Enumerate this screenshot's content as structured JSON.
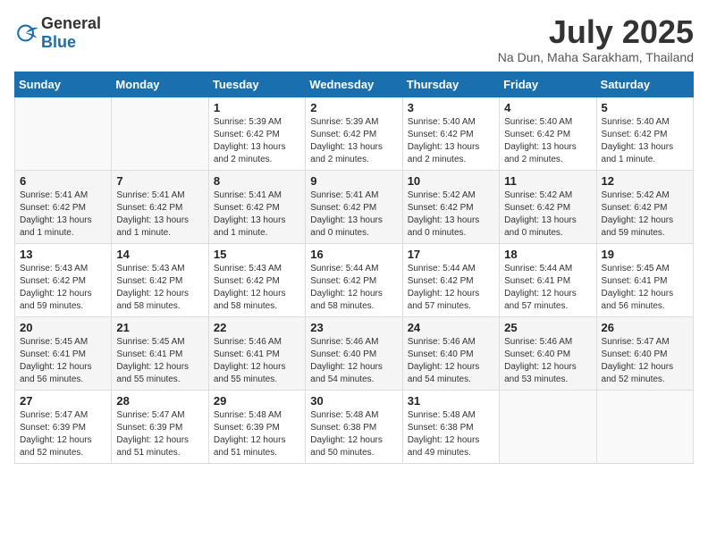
{
  "header": {
    "logo_general": "General",
    "logo_blue": "Blue",
    "month": "July 2025",
    "location": "Na Dun, Maha Sarakham, Thailand"
  },
  "weekdays": [
    "Sunday",
    "Monday",
    "Tuesday",
    "Wednesday",
    "Thursday",
    "Friday",
    "Saturday"
  ],
  "weeks": [
    [
      {
        "day": "",
        "info": ""
      },
      {
        "day": "",
        "info": ""
      },
      {
        "day": "1",
        "info": "Sunrise: 5:39 AM\nSunset: 6:42 PM\nDaylight: 13 hours and 2 minutes."
      },
      {
        "day": "2",
        "info": "Sunrise: 5:39 AM\nSunset: 6:42 PM\nDaylight: 13 hours and 2 minutes."
      },
      {
        "day": "3",
        "info": "Sunrise: 5:40 AM\nSunset: 6:42 PM\nDaylight: 13 hours and 2 minutes."
      },
      {
        "day": "4",
        "info": "Sunrise: 5:40 AM\nSunset: 6:42 PM\nDaylight: 13 hours and 2 minutes."
      },
      {
        "day": "5",
        "info": "Sunrise: 5:40 AM\nSunset: 6:42 PM\nDaylight: 13 hours and 1 minute."
      }
    ],
    [
      {
        "day": "6",
        "info": "Sunrise: 5:41 AM\nSunset: 6:42 PM\nDaylight: 13 hours and 1 minute."
      },
      {
        "day": "7",
        "info": "Sunrise: 5:41 AM\nSunset: 6:42 PM\nDaylight: 13 hours and 1 minute."
      },
      {
        "day": "8",
        "info": "Sunrise: 5:41 AM\nSunset: 6:42 PM\nDaylight: 13 hours and 1 minute."
      },
      {
        "day": "9",
        "info": "Sunrise: 5:41 AM\nSunset: 6:42 PM\nDaylight: 13 hours and 0 minutes."
      },
      {
        "day": "10",
        "info": "Sunrise: 5:42 AM\nSunset: 6:42 PM\nDaylight: 13 hours and 0 minutes."
      },
      {
        "day": "11",
        "info": "Sunrise: 5:42 AM\nSunset: 6:42 PM\nDaylight: 13 hours and 0 minutes."
      },
      {
        "day": "12",
        "info": "Sunrise: 5:42 AM\nSunset: 6:42 PM\nDaylight: 12 hours and 59 minutes."
      }
    ],
    [
      {
        "day": "13",
        "info": "Sunrise: 5:43 AM\nSunset: 6:42 PM\nDaylight: 12 hours and 59 minutes."
      },
      {
        "day": "14",
        "info": "Sunrise: 5:43 AM\nSunset: 6:42 PM\nDaylight: 12 hours and 58 minutes."
      },
      {
        "day": "15",
        "info": "Sunrise: 5:43 AM\nSunset: 6:42 PM\nDaylight: 12 hours and 58 minutes."
      },
      {
        "day": "16",
        "info": "Sunrise: 5:44 AM\nSunset: 6:42 PM\nDaylight: 12 hours and 58 minutes."
      },
      {
        "day": "17",
        "info": "Sunrise: 5:44 AM\nSunset: 6:42 PM\nDaylight: 12 hours and 57 minutes."
      },
      {
        "day": "18",
        "info": "Sunrise: 5:44 AM\nSunset: 6:41 PM\nDaylight: 12 hours and 57 minutes."
      },
      {
        "day": "19",
        "info": "Sunrise: 5:45 AM\nSunset: 6:41 PM\nDaylight: 12 hours and 56 minutes."
      }
    ],
    [
      {
        "day": "20",
        "info": "Sunrise: 5:45 AM\nSunset: 6:41 PM\nDaylight: 12 hours and 56 minutes."
      },
      {
        "day": "21",
        "info": "Sunrise: 5:45 AM\nSunset: 6:41 PM\nDaylight: 12 hours and 55 minutes."
      },
      {
        "day": "22",
        "info": "Sunrise: 5:46 AM\nSunset: 6:41 PM\nDaylight: 12 hours and 55 minutes."
      },
      {
        "day": "23",
        "info": "Sunrise: 5:46 AM\nSunset: 6:40 PM\nDaylight: 12 hours and 54 minutes."
      },
      {
        "day": "24",
        "info": "Sunrise: 5:46 AM\nSunset: 6:40 PM\nDaylight: 12 hours and 54 minutes."
      },
      {
        "day": "25",
        "info": "Sunrise: 5:46 AM\nSunset: 6:40 PM\nDaylight: 12 hours and 53 minutes."
      },
      {
        "day": "26",
        "info": "Sunrise: 5:47 AM\nSunset: 6:40 PM\nDaylight: 12 hours and 52 minutes."
      }
    ],
    [
      {
        "day": "27",
        "info": "Sunrise: 5:47 AM\nSunset: 6:39 PM\nDaylight: 12 hours and 52 minutes."
      },
      {
        "day": "28",
        "info": "Sunrise: 5:47 AM\nSunset: 6:39 PM\nDaylight: 12 hours and 51 minutes."
      },
      {
        "day": "29",
        "info": "Sunrise: 5:48 AM\nSunset: 6:39 PM\nDaylight: 12 hours and 51 minutes."
      },
      {
        "day": "30",
        "info": "Sunrise: 5:48 AM\nSunset: 6:38 PM\nDaylight: 12 hours and 50 minutes."
      },
      {
        "day": "31",
        "info": "Sunrise: 5:48 AM\nSunset: 6:38 PM\nDaylight: 12 hours and 49 minutes."
      },
      {
        "day": "",
        "info": ""
      },
      {
        "day": "",
        "info": ""
      }
    ]
  ]
}
